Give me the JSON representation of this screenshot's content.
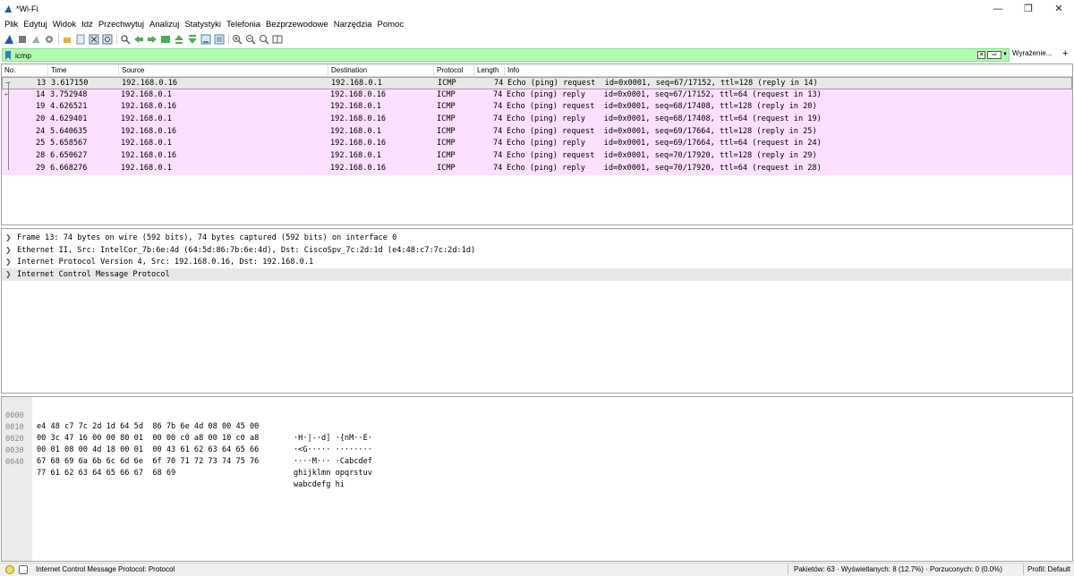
{
  "window": {
    "title": "*Wi-Fi"
  },
  "menu": [
    "Plik",
    "Edytuj",
    "Widok",
    "Idź",
    "Przechwytuj",
    "Analizuj",
    "Statystyki",
    "Telefonia",
    "Bezprzewodowe",
    "Narzędzia",
    "Pomoc"
  ],
  "toolbar": {
    "icons": [
      "shark-fin-icon",
      "stop-icon",
      "restart-icon",
      "options-gear-icon",
      "open-folder-icon",
      "save-file-icon",
      "close-file-icon",
      "reload-icon",
      "find-icon",
      "go-back-icon",
      "go-forward-icon",
      "go-to-packet-icon",
      "first-packet-icon",
      "last-packet-icon",
      "autoscroll-icon",
      "colorize-icon",
      "zoom-in-icon",
      "zoom-out-icon",
      "zoom-normal-icon",
      "resize-columns-icon"
    ]
  },
  "filter": {
    "value": "icmp",
    "expressions_label": "Wyrażenie...",
    "add_label": "+"
  },
  "packet_list": {
    "columns": [
      "No.",
      "Time",
      "Source",
      "Destination",
      "Protocol",
      "Length",
      "Info"
    ],
    "rows": [
      {
        "no": "13",
        "time": "3.617150",
        "src": "192.168.0.16",
        "dst": "192.168.0.1",
        "proto": "ICMP",
        "len": "74",
        "info": "Echo (ping) request  id=0x0001, seq=67/17152, ttl=128 (reply in 14)"
      },
      {
        "no": "14",
        "time": "3.752948",
        "src": "192.168.0.1",
        "dst": "192.168.0.16",
        "proto": "ICMP",
        "len": "74",
        "info": "Echo (ping) reply    id=0x0001, seq=67/17152, ttl=64 (request in 13)"
      },
      {
        "no": "19",
        "time": "4.626521",
        "src": "192.168.0.16",
        "dst": "192.168.0.1",
        "proto": "ICMP",
        "len": "74",
        "info": "Echo (ping) request  id=0x0001, seq=68/17408, ttl=128 (reply in 20)"
      },
      {
        "no": "20",
        "time": "4.629401",
        "src": "192.168.0.1",
        "dst": "192.168.0.16",
        "proto": "ICMP",
        "len": "74",
        "info": "Echo (ping) reply    id=0x0001, seq=68/17408, ttl=64 (request in 19)"
      },
      {
        "no": "24",
        "time": "5.640635",
        "src": "192.168.0.16",
        "dst": "192.168.0.1",
        "proto": "ICMP",
        "len": "74",
        "info": "Echo (ping) request  id=0x0001, seq=69/17664, ttl=128 (reply in 25)"
      },
      {
        "no": "25",
        "time": "5.658567",
        "src": "192.168.0.1",
        "dst": "192.168.0.16",
        "proto": "ICMP",
        "len": "74",
        "info": "Echo (ping) reply    id=0x0001, seq=69/17664, ttl=64 (request in 24)"
      },
      {
        "no": "28",
        "time": "6.650627",
        "src": "192.168.0.16",
        "dst": "192.168.0.1",
        "proto": "ICMP",
        "len": "74",
        "info": "Echo (ping) request  id=0x0001, seq=70/17920, ttl=128 (reply in 29)"
      },
      {
        "no": "29",
        "time": "6.668276",
        "src": "192.168.0.1",
        "dst": "192.168.0.16",
        "proto": "ICMP",
        "len": "74",
        "info": "Echo (ping) reply    id=0x0001, seq=70/17920, ttl=64 (request in 28)"
      }
    ]
  },
  "details": [
    "Frame 13: 74 bytes on wire (592 bits), 74 bytes captured (592 bits) on interface 0",
    "Ethernet II, Src: IntelCor_7b:6e:4d (64:5d:86:7b:6e:4d), Dst: CiscoSpv_7c:2d:1d (e4:48:c7:7c:2d:1d)",
    "Internet Protocol Version 4, Src: 192.168.0.16, Dst: 192.168.0.1",
    "Internet Control Message Protocol"
  ],
  "bytes": [
    {
      "offset": "0000",
      "hex": "e4 48 c7 7c 2d 1d 64 5d  86 7b 6e 4d 08 00 45 00",
      "ascii": "·H·|-·d] ·{nM··E·"
    },
    {
      "offset": "0010",
      "hex": "00 3c 47 16 00 00 80 01  00 00 c0 a8 00 10 c0 a8",
      "ascii": "·<G····· ········"
    },
    {
      "offset": "0020",
      "hex": "00 01 08 00 4d 18 00 01  00 43 61 62 63 64 65 66",
      "ascii": "····M··· ·Cabcdef"
    },
    {
      "offset": "0030",
      "hex": "67 68 69 6a 6b 6c 6d 6e  6f 70 71 72 73 74 75 76",
      "ascii": "ghijklmn opqrstuv"
    },
    {
      "offset": "0040",
      "hex": "77 61 62 63 64 65 66 67  68 69",
      "ascii": "wabcdefg hi"
    }
  ],
  "status": {
    "field": "Internet Control Message Protocol: Protocol",
    "stats": "Pakietów: 63 · Wyświetlanych: 8 (12.7%) · Porzuconych: 0 (0.0%)",
    "profile": "Profil: Default"
  },
  "colors": {
    "filter_ok": "#afffaf",
    "icmp_row": "#fce0ff",
    "selected_row": "#e8e8e8"
  }
}
